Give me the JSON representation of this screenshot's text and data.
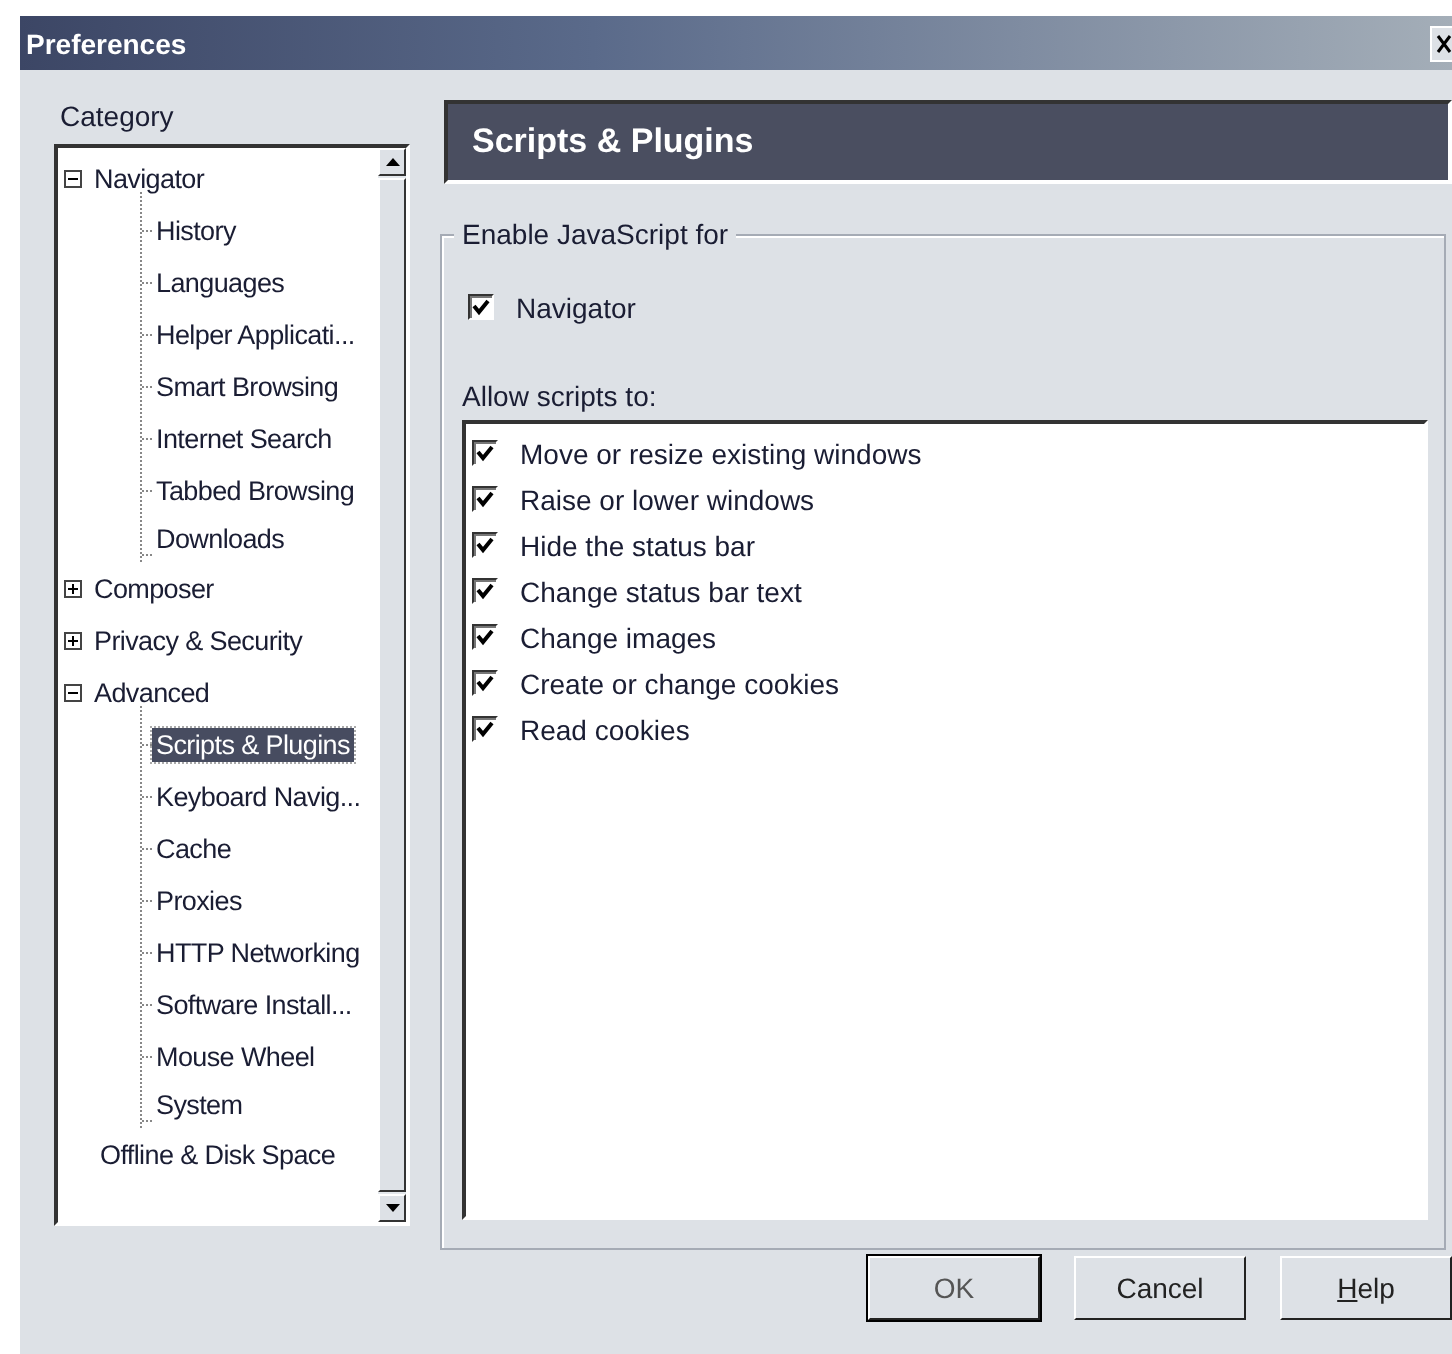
{
  "window": {
    "title": "Preferences"
  },
  "category": {
    "label": "Category",
    "items": [
      {
        "label": "Navigator",
        "expanded": true,
        "selected": false,
        "children": [
          {
            "label": "History",
            "selected": false
          },
          {
            "label": "Languages",
            "selected": false
          },
          {
            "label": "Helper Applicati...",
            "selected": false
          },
          {
            "label": "Smart Browsing",
            "selected": false
          },
          {
            "label": "Internet Search",
            "selected": false
          },
          {
            "label": "Tabbed Browsing",
            "selected": false
          },
          {
            "label": "Downloads",
            "selected": false
          }
        ]
      },
      {
        "label": "Composer",
        "expanded": false,
        "selected": false
      },
      {
        "label": "Privacy & Security",
        "expanded": false,
        "selected": false
      },
      {
        "label": "Advanced",
        "expanded": true,
        "selected": false,
        "children": [
          {
            "label": "Scripts & Plugins",
            "selected": true
          },
          {
            "label": "Keyboard Navig...",
            "selected": false
          },
          {
            "label": "Cache",
            "selected": false
          },
          {
            "label": "Proxies",
            "selected": false
          },
          {
            "label": "HTTP Networking",
            "selected": false
          },
          {
            "label": "Software Install...",
            "selected": false
          },
          {
            "label": "Mouse Wheel",
            "selected": false
          },
          {
            "label": "System",
            "selected": false
          }
        ]
      },
      {
        "label": "Offline & Disk Space",
        "selected": false
      }
    ]
  },
  "panel": {
    "title": "Scripts & Plugins",
    "group": {
      "legend": "Enable JavaScript for",
      "enable": [
        {
          "label": "Navigator",
          "checked": true
        }
      ],
      "allow_label": "Allow scripts to:",
      "allow": [
        {
          "label": "Move or resize existing windows",
          "checked": true
        },
        {
          "label": "Raise or lower windows",
          "checked": true
        },
        {
          "label": "Hide the status bar",
          "checked": true
        },
        {
          "label": "Change status bar text",
          "checked": true
        },
        {
          "label": "Change images",
          "checked": true
        },
        {
          "label": "Create or change cookies",
          "checked": true
        },
        {
          "label": "Read cookies",
          "checked": true
        }
      ]
    }
  },
  "buttons": [
    {
      "label": "OK",
      "default": true,
      "underline_first": false
    },
    {
      "label": "Cancel",
      "default": false,
      "underline_first": false
    },
    {
      "label": "Help",
      "default": false,
      "underline_first": true
    }
  ]
}
